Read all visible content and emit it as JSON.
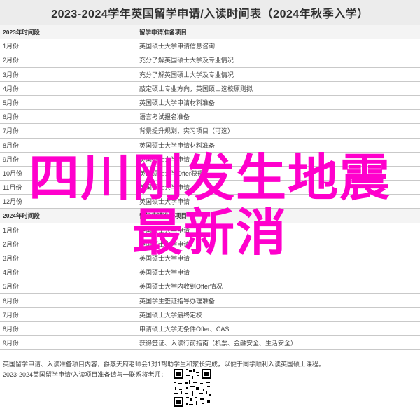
{
  "title": "2023-2024学年英国留学申请/入读时间表（2024年秋季入学）",
  "sections": [
    {
      "header_left": "2023年时间段",
      "header_right": "留学申请准备项目",
      "rows": [
        {
          "month": "1月份",
          "task": "英国硕士大学申请信息咨询"
        },
        {
          "month": "2月份",
          "task": "充分了解英国硕士大学及专业情况"
        },
        {
          "month": "3月份",
          "task": "充分了解英国硕士大学及专业情况"
        },
        {
          "month": "4月份",
          "task": "敲定硕士专业方向，英国硕士选校原则拟"
        },
        {
          "month": "5月份",
          "task": "英国硕士大学申请材料准备"
        },
        {
          "month": "6月份",
          "task": "语言考试报名准备"
        },
        {
          "month": "7月份",
          "task": "背景提升规划、实习项目（可选）"
        },
        {
          "month": "8月份",
          "task": "英国硕士大学申请材料准备"
        },
        {
          "month": "9月份",
          "task": "英国硕士大学申请"
        },
        {
          "month": "10月份",
          "task": "英国硕士大学Offer获得"
        },
        {
          "month": "11月份",
          "task": "英国硕士大学申请"
        },
        {
          "month": "12月份",
          "task": "英国硕士大学申请"
        }
      ]
    },
    {
      "header_left": "2024年时间段",
      "header_right": "留学申请准备项目",
      "rows": [
        {
          "month": "1月份",
          "task": "英国硕士大学申请"
        },
        {
          "month": "2月份",
          "task": "英国硕士大学申请"
        },
        {
          "month": "3月份",
          "task": "英国硕士大学申请"
        },
        {
          "month": "4月份",
          "task": "英国硕士大学申请"
        },
        {
          "month": "5月份",
          "task": "英国硕士大学内收到Offer情况"
        },
        {
          "month": "6月份",
          "task": "英国学生签证指导办理准备"
        },
        {
          "month": "7月份",
          "task": "英国硕士大学最终定校"
        },
        {
          "month": "8月份",
          "task": "申请硕士大学无条件Offer、CAS"
        },
        {
          "month": "9月份",
          "task": "获得签证、入读行前指南（机票、金融安全、生活安全）"
        }
      ]
    }
  ],
  "footnote_1": "英国留学申请、入读准备项目内容，爵蒸天府老师会1对1帮助学生和家长完成，以便于同学顺利入读英国硕士课程。",
  "footnote_2": "2023-2024英国留学申请/入读项目准备请与一联系将老师：",
  "overlay_line1": "四川刚发生地震",
  "overlay_line2": "最新消"
}
